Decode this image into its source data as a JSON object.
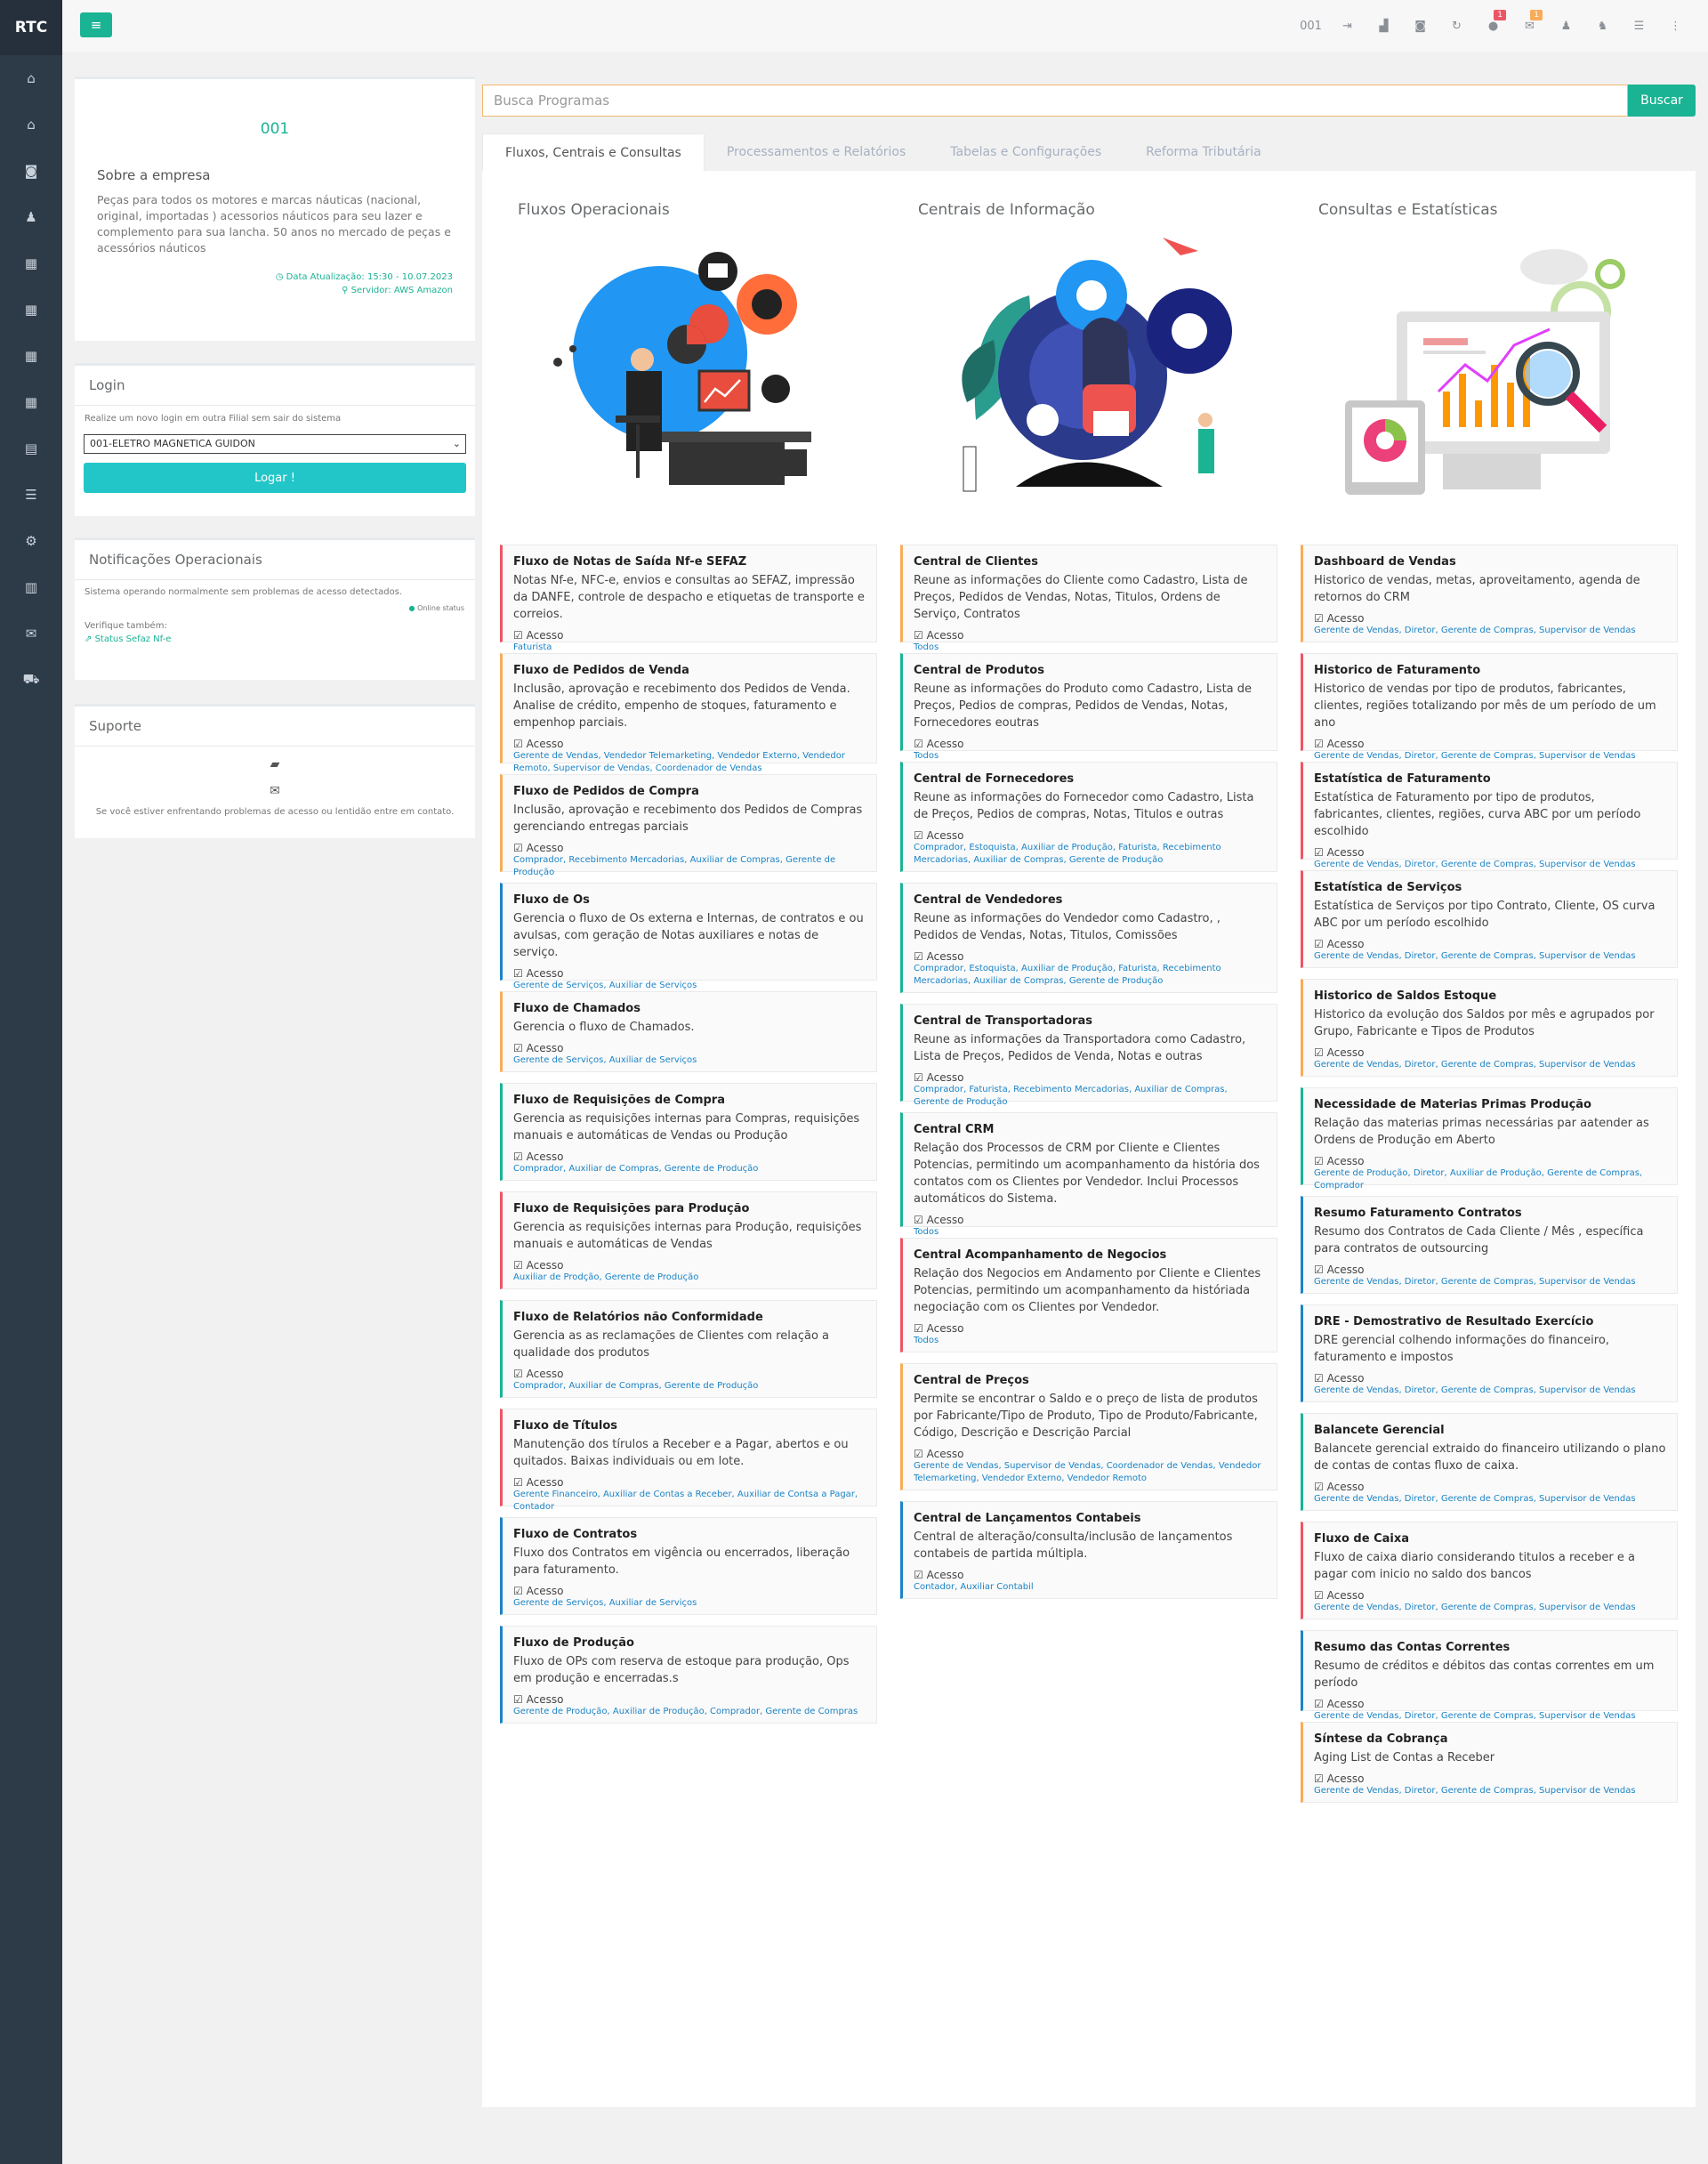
{
  "app": {
    "brand": "RTC",
    "menu_icon": "menu-icon",
    "top_code": "001"
  },
  "sidebar_icons": [
    "home-icon",
    "home-icon",
    "camera-icon",
    "user-icon",
    "grid-icon",
    "grid-icon",
    "grid-icon",
    "grid-icon",
    "table-icon",
    "database-icon",
    "gear-icon",
    "chart-icon",
    "envelope-icon",
    "cart-icon"
  ],
  "top_icons": [
    {
      "name": "signout-icon",
      "glyph": "⇥"
    },
    {
      "name": "chart-area-icon",
      "glyph": "▟"
    },
    {
      "name": "camera-icon",
      "glyph": "◙"
    },
    {
      "name": "refresh-icon",
      "glyph": "↻"
    },
    {
      "name": "comments-icon",
      "glyph": "●",
      "badge": "1"
    },
    {
      "name": "envelope-icon",
      "glyph": "✉",
      "badge": "1"
    },
    {
      "name": "user-icon",
      "glyph": "♟"
    },
    {
      "name": "users-icon",
      "glyph": "♞"
    },
    {
      "name": "list-icon",
      "glyph": "☰"
    },
    {
      "name": "more-icon",
      "glyph": "⋮"
    }
  ],
  "company": {
    "code": "001",
    "about_title": "Sobre a empresa",
    "about_text": "Peças para todos os motores e marcas náuticas (nacional, original, importadas ) acessorios náuticos para seu lazer e complemento para sua lancha. 50 anos no mercado de peças e acessórios náuticos",
    "updated": "Data Atualização:  15:30 - 10.07.2023",
    "server": "Servidor: AWS Amazon"
  },
  "login": {
    "title": "Login",
    "hint": "Realize um novo login em outra Filial sem sair do sistema",
    "branch": "001-ELETRO MAGNETICA GUIDON",
    "button": "Logar !"
  },
  "notif": {
    "title": "Notificações Operacionais",
    "text": "Sistema operando normalmente sem problemas de acesso detectados.",
    "status": "Online status",
    "verify": "Verifique também:",
    "link": "Status Sefaz Nf-e"
  },
  "support": {
    "title": "Suporte",
    "text": "Se você estiver enfrentando problemas de acesso ou lentidão entre em contato."
  },
  "search": {
    "placeholder": "Busca Programas",
    "button": "Buscar"
  },
  "tabs": [
    "Fluxos, Centrais e Consultas",
    "Processamentos e Relatórios",
    "Tabelas e Configurações",
    "Reforma Tributária"
  ],
  "access_label": "Acesso",
  "columns": [
    {
      "title": "Fluxos Operacionais",
      "cards": [
        {
          "title": "Fluxo de Notas de Saída Nf-e SEFAZ",
          "desc": "Notas Nf-e, NFC-e, envios e consultas ao SEFAZ, impressão da DANFE, controle de despacho e etiquetas de transporte e correios.",
          "roles": "Faturista",
          "color": "r"
        },
        {
          "title": "Fluxo de Pedidos de Venda",
          "desc": "Inclusão, aprovação e recebimento dos Pedidos de Venda. Analise de crédito, empenho de stoques, faturamento e empenhop parciais.",
          "roles": "Gerente de Vendas, Vendedor Telemarketing, Vendedor Externo, Vendedor Remoto, Supervisor de Vendas, Coordenador de Vendas",
          "color": "o"
        },
        {
          "title": "Fluxo de Pedidos de Compra",
          "desc": "Inclusão, aprovação e recebimento dos Pedidos de Compras gerenciando entregas parciais",
          "roles": "Comprador, Recebimento Mercadorias, Auxiliar de Compras, Gerente de Produção",
          "color": "o"
        },
        {
          "title": "Fluxo de Os",
          "desc": "Gerencia o fluxo de Os externa e Internas, de contratos e ou avulsas, com geração de Notas auxiliares e notas de serviço.",
          "roles": "Gerente de Serviços, Auxiliar de Serviços",
          "color": "b"
        },
        {
          "title": "Fluxo de Chamados",
          "desc": "Gerencia o fluxo de Chamados.",
          "roles": "Gerente de Serviços, Auxiliar de Serviços",
          "color": "o"
        },
        {
          "title": "Fluxo de Requisições de Compra",
          "desc": "Gerencia as requisições internas para Compras, requisições manuais e automáticas de Vendas ou Produção",
          "roles": "Comprador, Auxiliar de Compras, Gerente de Produção",
          "color": "g"
        },
        {
          "title": "Fluxo de Requisições para Produção",
          "desc": "Gerencia as requisições internas para Produção, requisições manuais e automáticas de Vendas",
          "roles": "Auxiliar de Prodção, Gerente de Produção",
          "color": "r"
        },
        {
          "title": "Fluxo de Relatórios não Conformidade",
          "desc": "Gerencia as as reclamações de Clientes com relação a qualidade dos produtos",
          "roles": "Comprador, Auxiliar de Compras, Gerente de Produção",
          "color": "g"
        },
        {
          "title": "Fluxo de Títulos",
          "desc": "Manutenção dos tírulos a Receber e a Pagar, abertos e ou quitados. Baixas individuais ou em lote.",
          "roles": "Gerente Financeiro, Auxiliar de Contas a Receber, Auxiliar de Contsa a Pagar, Contador",
          "color": "r"
        },
        {
          "title": "Fluxo de Contratos",
          "desc": "Fluxo dos Contratos em vigência ou encerrados, liberação para faturamento.",
          "roles": "Gerente de Serviços, Auxiliar de Serviços",
          "color": "b"
        },
        {
          "title": "Fluxo de Produção",
          "desc": "Fluxo de OPs com reserva de estoque para produção, Ops em produção e encerradas.s",
          "roles": "Gerente de Produção, Auxiliar de Produção, Comprador, Gerente de Compras",
          "color": "b"
        }
      ]
    },
    {
      "title": "Centrais de Informação",
      "cards": [
        {
          "title": "Central de Clientes",
          "desc": "Reune as informações do Cliente como Cadastro, Lista de Preços, Pedidos de Vendas, Notas, Titulos, Ordens de Serviço, Contratos",
          "roles": "Todos",
          "color": "o"
        },
        {
          "title": "Central de Produtos",
          "desc": "Reune as informações do Produto como Cadastro, Lista de Preços, Pedios de compras, Pedidos de Vendas, Notas, Fornecedores eoutras",
          "roles": "Todos",
          "color": "g"
        },
        {
          "title": "Central de Fornecedores",
          "desc": "Reune as informações do Fornecedor como Cadastro, Lista de Preços, Pedios de compras, Notas, Titulos e outras",
          "roles": "Comprador, Estoquista, Auxiliar de Produção, Faturista, Recebimento Mercadorias, Auxiliar de Compras, Gerente de Produção",
          "color": "g"
        },
        {
          "title": "Central de Vendedores",
          "desc": "Reune as informações do Vendedor como Cadastro, , Pedidos de Vendas, Notas, Titulos, Comissões",
          "roles": "Comprador, Estoquista, Auxiliar de Produção, Faturista, Recebimento Mercadorias, Auxiliar de Compras, Gerente de Produção",
          "color": "g"
        },
        {
          "title": "Central de Transportadoras",
          "desc": "Reune as informações da Transportadora como Cadastro, Lista de Preços, Pedidos de Venda, Notas e outras",
          "roles": "Comprador, Faturista, Recebimento Mercadorias, Auxiliar de Compras, Gerente de Produção",
          "color": "g"
        },
        {
          "title": "Central CRM",
          "desc": "Relação dos Processos de CRM por Cliente e Clientes Potencias, permitindo um acompanhamento da história dos contatos com os Clientes por Vendedor. Inclui Processos automáticos do Sistema.",
          "roles": "Todos",
          "color": "g"
        },
        {
          "title": "Central Acompanhamento de Negocios",
          "desc": "Relação dos Negocios em Andamento por Cliente e Clientes Potencias, permitindo um acompanhamento da históriada negociação com os Clientes por Vendedor.",
          "roles": "Todos",
          "color": "r"
        },
        {
          "title": "Central de Preços",
          "desc": "Permite se encontrar o Saldo e o preço de lista de produtos por Fabricante/Tipo de Produto, Tipo de Produto/Fabricante, Código, Descrição e Descrição Parcial",
          "roles": "Gerente de Vendas, Supervisor de Vendas, Coordenador de Vendas, Vendedor Telemarketing, Vendedor Externo, Vendedor Remoto",
          "color": "o"
        },
        {
          "title": "Central de Lançamentos Contabeis",
          "desc": "Central de alteração/consulta/inclusão de lançamentos contabeis de partida múltipla.",
          "roles": "Contador, Auxiliar Contabil",
          "color": "b"
        }
      ]
    },
    {
      "title": "Consultas e Estatísticas",
      "cards": [
        {
          "title": "Dashboard de Vendas",
          "desc": "Historico de vendas, metas, aproveitamento, agenda de retornos do CRM",
          "roles": "Gerente de Vendas, Diretor, Gerente de Compras, Supervisor de Vendas",
          "color": "o"
        },
        {
          "title": "Historico de Faturamento",
          "desc": "Historico de vendas por tipo de produtos, fabricantes, clientes, regiões totalizando por mês de um período de um ano",
          "roles": "Gerente de Vendas, Diretor, Gerente de Compras, Supervisor de Vendas",
          "color": "r"
        },
        {
          "title": "Estatística de Faturamento",
          "desc": "Estatística de Faturamento por tipo de produtos, fabricantes, clientes, regiões, curva ABC por um período escolhido",
          "roles": "Gerente de Vendas, Diretor, Gerente de Compras, Supervisor de Vendas",
          "color": "r"
        },
        {
          "title": "Estatística de Serviços",
          "desc": "Estatística de Serviços por tipo Contrato, Cliente, OS curva ABC por um período escolhido",
          "roles": "Gerente de Vendas, Diretor, Gerente de Compras, Supervisor de Vendas",
          "color": "r"
        },
        {
          "title": "Historico de Saldos Estoque",
          "desc": "Historico da evolução dos Saldos por mês e agrupados por Grupo, Fabricante e Tipos de Produtos",
          "roles": "Gerente de Vendas, Diretor, Gerente de Compras, Supervisor de Vendas",
          "color": "o"
        },
        {
          "title": "Necessidade de Materias Primas Produção",
          "desc": "Relação das materias primas necessárias par aatender as Ordens de Produção em Aberto",
          "roles": "Gerente de Produção, Diretor, Auxiliar de Produção, Gerente de Compras, Comprador",
          "color": "g"
        },
        {
          "title": "Resumo Faturamento Contratos",
          "desc": "Resumo dos Contratos de Cada Cliente / Mês , específica para contratos de outsourcing",
          "roles": "Gerente de Vendas, Diretor, Gerente de Compras, Supervisor de Vendas",
          "color": "b"
        },
        {
          "title": "DRE - Demostrativo de Resultado Exercício",
          "desc": "DRE gerencial colhendo informações do financeiro, faturamento e impostos",
          "roles": "Gerente de Vendas, Diretor, Gerente de Compras, Supervisor de Vendas",
          "color": "b"
        },
        {
          "title": "Balancete Gerencial",
          "desc": "Balancete gerencial extraido do financeiro utilizando o plano de contas de contas fluxo de caixa.",
          "roles": "Gerente de Vendas, Diretor, Gerente de Compras, Supervisor de Vendas",
          "color": "g"
        },
        {
          "title": "Fluxo de Caixa",
          "desc": "Fluxo de caixa diario considerando titulos a receber e a pagar com inicio no saldo dos bancos",
          "roles": "Gerente de Vendas, Diretor, Gerente de Compras, Supervisor de Vendas",
          "color": "r"
        },
        {
          "title": "Resumo das Contas Correntes",
          "desc": "Resumo de créditos e débitos das contas correntes em um período",
          "roles": "Gerente de Vendas, Diretor, Gerente de Compras, Supervisor de Vendas",
          "color": "b"
        },
        {
          "title": "Síntese da Cobrança",
          "desc": "Aging List de Contas a Receber",
          "roles": "Gerente de Vendas, Diretor, Gerente de Compras, Supervisor de Vendas",
          "color": "o"
        }
      ]
    }
  ]
}
